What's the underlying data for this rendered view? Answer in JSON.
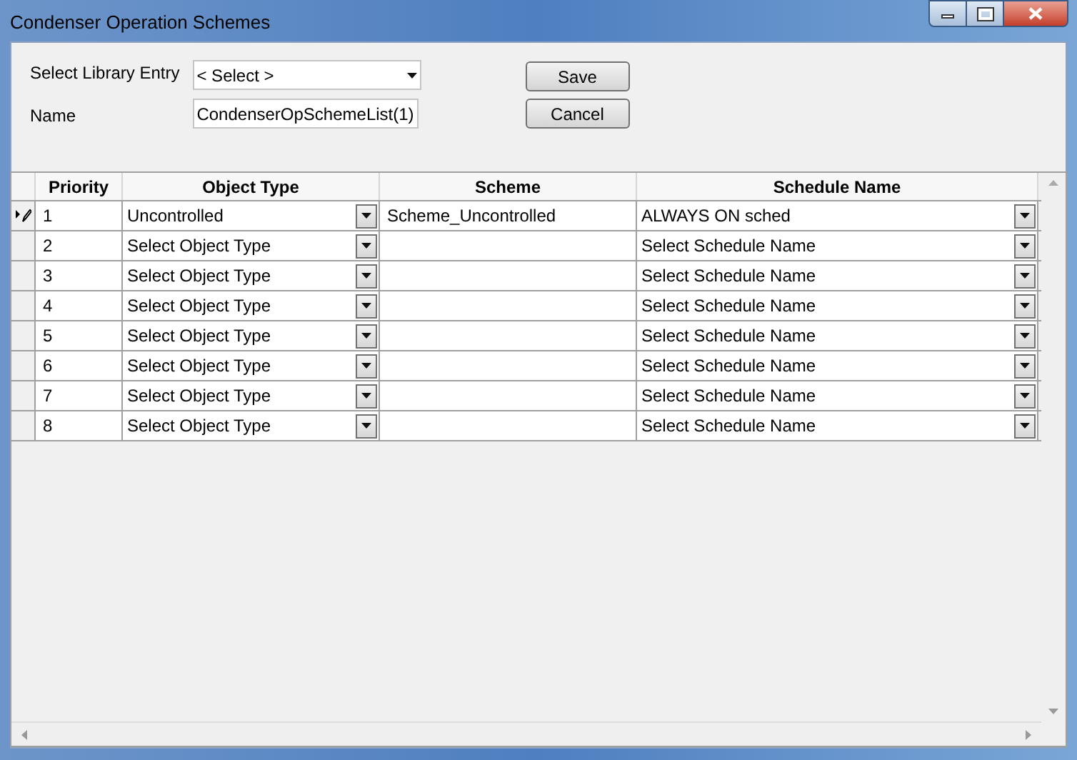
{
  "window": {
    "title": "Condenser Operation Schemes"
  },
  "form": {
    "library_label": "Select Library Entry",
    "library_value": "< Select >",
    "name_label": "Name",
    "name_value": "CondenserOpSchemeList(1)",
    "buttons": [
      "Save",
      "Cancel"
    ]
  },
  "table": {
    "columns": [
      "Priority",
      "Object Type",
      "Scheme",
      "Schedule Name"
    ],
    "rows": [
      {
        "priority": "1",
        "object_type": "Uncontrolled",
        "scheme": "Scheme_Uncontrolled",
        "schedule": "ALWAYS ON sched",
        "editing": true
      },
      {
        "priority": "2",
        "object_type": "Select Object Type",
        "schedule": "Select Schedule Name",
        "editing": false
      },
      {
        "priority": "3",
        "object_type": "Select Object Type",
        "schedule": "Select Schedule Name",
        "editing": false
      },
      {
        "priority": "4",
        "object_type": "Select Object Type",
        "schedule": "Select Schedule Name",
        "editing": false
      },
      {
        "priority": "5",
        "object_type": "Select Object Type",
        "schedule": "Select Schedule Name",
        "editing": false
      },
      {
        "priority": "6",
        "object_type": "Select Object Type",
        "schedule": "Select Schedule Name",
        "editing": false
      },
      {
        "priority": "7",
        "object_type": "Select Object Type",
        "schedule": "Select Schedule Name",
        "editing": false
      },
      {
        "priority": "8",
        "object_type": "Select Object Type",
        "schedule": "Select Schedule Name",
        "editing": false
      }
    ]
  }
}
